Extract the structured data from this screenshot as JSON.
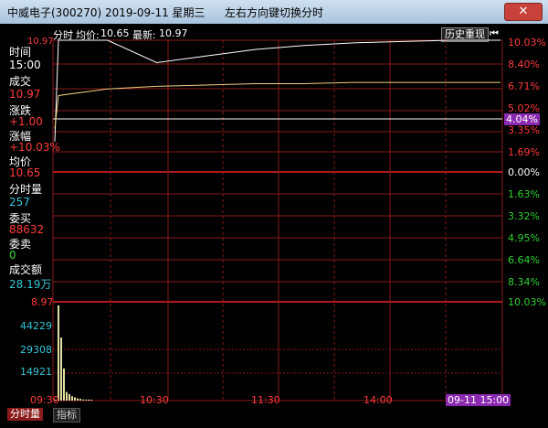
{
  "window": {
    "title": "中威电子(300270) 2019-09-11 星期三",
    "hint": "左右方向键切换分时",
    "close_icon": "close-icon"
  },
  "header": {
    "mode": "分时",
    "avg_label": "均价:",
    "avg_value": "10.65",
    "latest_label": "最新:",
    "latest_value": "10.97",
    "history_button": "历史重现",
    "history_icon": "rewind-icon"
  },
  "price_axis": {
    "top": "10.03%",
    "labels_up": [
      "10.03%",
      "8.40%",
      "6.71%",
      "5.02%",
      "4.04%",
      "3.35%",
      "1.69%"
    ],
    "zero": "0.00%",
    "labels_down": [
      "1.63%",
      "3.32%",
      "4.95%",
      "6.64%",
      "8.34%",
      "10.03%"
    ],
    "left_top": "10.97"
  },
  "info_panel": {
    "time_label": "时间",
    "time_value": "15:00",
    "deal_label": "成交",
    "deal_value": "10.97",
    "change_label": "涨跌",
    "change_value": "+1.00",
    "pct_label": "涨幅",
    "pct_value": "+10.03%",
    "avg_label": "均价",
    "avg_value": "10.65",
    "vol_label": "分时量",
    "vol_value": "257",
    "buy_label": "委买",
    "buy_value": "88632",
    "sell_label": "委卖",
    "sell_value": "0",
    "amount_label": "成交额",
    "amount_value": "28.19万"
  },
  "volume_axis": {
    "labels": [
      "8.97",
      "44229",
      "29308",
      "14921"
    ]
  },
  "time_axis": {
    "labels": [
      "09:30",
      "10:30",
      "11:30",
      "14:00"
    ],
    "selected": "09-11 15:00"
  },
  "bottom_tabs": {
    "tab1": "分时量",
    "tab2": "指标"
  },
  "colors": {
    "red_up": "#ff3b3b",
    "green_down": "#2fd12f",
    "white": "#ffffff",
    "cyan": "#34c7d9",
    "grid_red": "#8b1a1a",
    "highlight": "#8b2ab0"
  },
  "chart_data": {
    "type": "line",
    "price_series": [
      10.2,
      10.97,
      10.97,
      10.8,
      10.85,
      10.9,
      10.93,
      10.95,
      10.96,
      10.97,
      10.97
    ],
    "avg_series": [
      10.3,
      10.55,
      10.6,
      10.62,
      10.63,
      10.64,
      10.64,
      10.65,
      10.65,
      10.65,
      10.65
    ],
    "volume_series": [
      8,
      44229,
      29308,
      14921,
      4000,
      3000,
      2000,
      1500,
      1000,
      800,
      500,
      400,
      300,
      257
    ]
  }
}
